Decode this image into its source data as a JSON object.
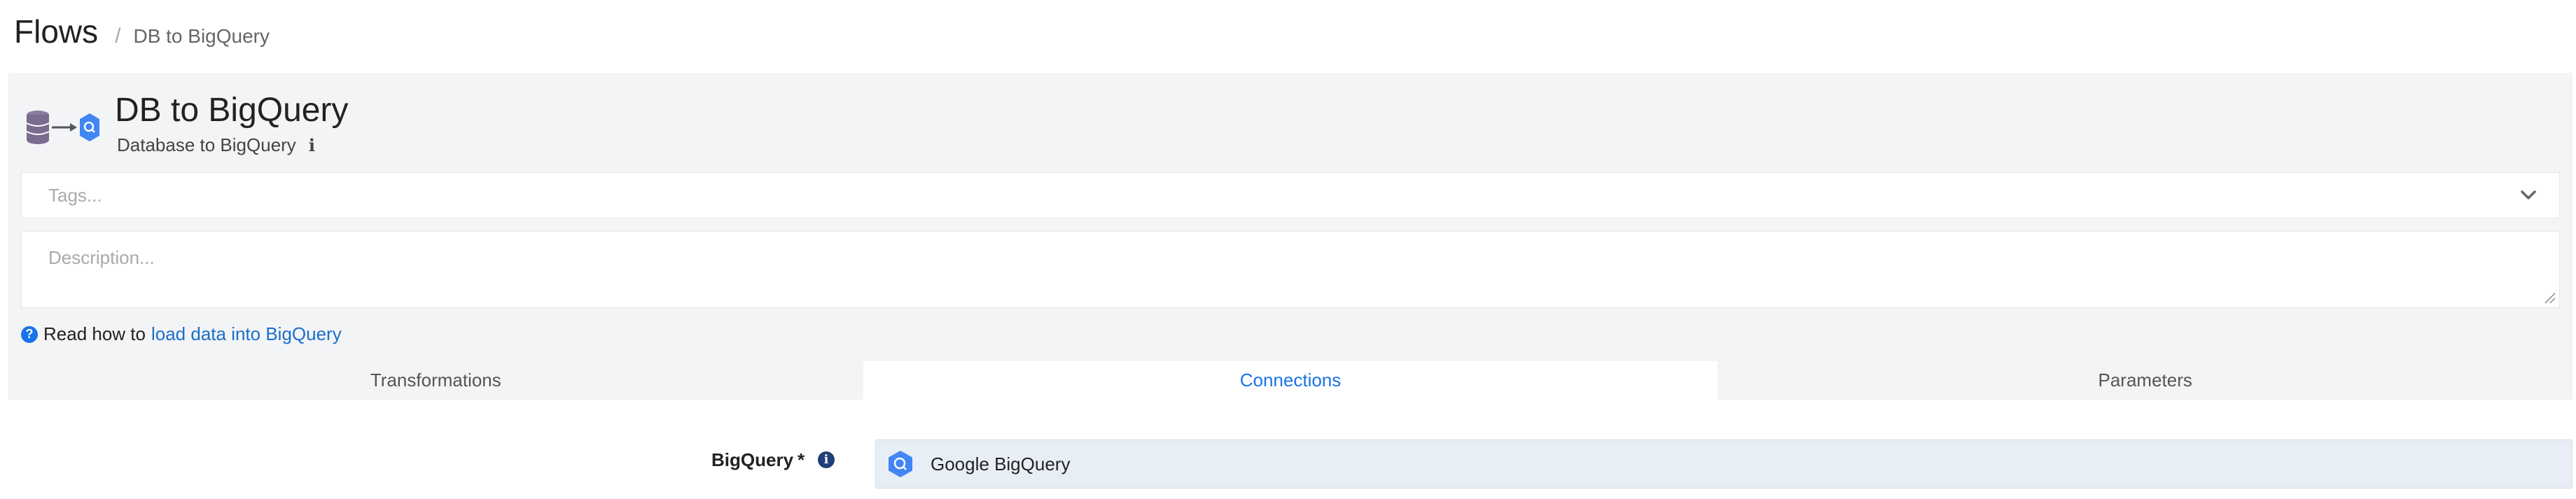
{
  "breadcrumb": {
    "root": "Flows",
    "separator": "/",
    "current": "DB to BigQuery"
  },
  "flow": {
    "title": "DB to BigQuery",
    "subtitle": "Database to BigQuery",
    "info_glyph": "i"
  },
  "tags": {
    "placeholder": "Tags..."
  },
  "description": {
    "placeholder": "Description..."
  },
  "help": {
    "icon_glyph": "?",
    "prefix": "Read how to",
    "link_text": "load data into BigQuery"
  },
  "tabs": [
    {
      "label": "Transformations",
      "active": false
    },
    {
      "label": "Connections",
      "active": true
    },
    {
      "label": "Parameters",
      "active": false
    }
  ],
  "connection": {
    "label": "BigQuery",
    "required_mark": "*",
    "info_glyph": "i",
    "value": "Google BigQuery"
  },
  "colors": {
    "accent": "#1a73e8",
    "link": "#1a6fc9",
    "panel_bg": "#f3f4f6",
    "select_bg": "#e8eef6",
    "db_icon": "#7a6b8f"
  },
  "icons": [
    "database-icon",
    "arrow-right-icon",
    "bigquery-icon",
    "info-icon",
    "chevron-down-icon",
    "question-circle-icon"
  ]
}
